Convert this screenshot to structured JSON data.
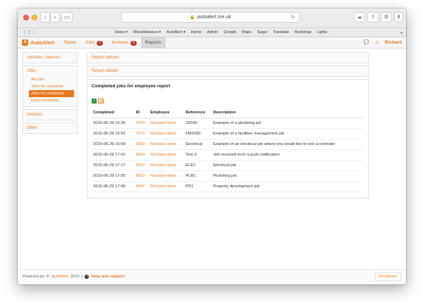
{
  "browser": {
    "url": "autoalert.me.uk",
    "bookmarks": [
      "News ▾",
      "Miscellaneous ▾",
      "AutoAlert ▾",
      "Home",
      "Admin",
      "Google",
      "Maps",
      "Sugar",
      "Translate",
      "Bootstrap",
      "Lights"
    ]
  },
  "app": {
    "brand": "AutoAlert",
    "nav": [
      {
        "label": "Radar"
      },
      {
        "label": "Jobs",
        "badge": "7"
      },
      {
        "label": "Invoices",
        "badge": "2"
      },
      {
        "label": "Reports",
        "active": true
      }
    ],
    "user": "Richard"
  },
  "sidebar": {
    "vehicles": "Vehicles / devices",
    "jobs": "Jobs",
    "jobs_items": [
      "All jobs",
      "Jobs for customer",
      "Jobs for employee",
      "Daily checklists"
    ],
    "jobs_active_index": 2,
    "invoices": "Invoices",
    "other": "Other"
  },
  "main": {
    "report_options": "Report options",
    "report_details": "Report details",
    "report_title": "Completed jobs for employee report",
    "columns": [
      "Completed",
      "ID",
      "Employee",
      "Reference",
      "Description"
    ],
    "rows": [
      [
        "2015-06-29 16:39",
        "7073",
        "Richard Harris",
        "JX540",
        "Example of a plumbing job"
      ],
      [
        "2015-06-29 16:52",
        "7072",
        "Richard Harris",
        "FM3330",
        "Example of a facilities management job"
      ],
      [
        "2015-06-29 16:59",
        "6962",
        "Richard Harris",
        "Electrical",
        "Example of an electrical job where you would like to see a reminder"
      ],
      [
        "2015-06-29 17:02",
        "6814",
        "Richard Harris",
        "Test 3",
        "Job received from a push notification"
      ],
      [
        "2015-06-29 17:17",
        "6813",
        "Richard Harris",
        "ELE1",
        "Electrical job"
      ],
      [
        "2015-06-29 17:05",
        "6812",
        "Richard Harris",
        "PLB1",
        "Plumbing job"
      ],
      [
        "2015-06-29 17:05",
        "6647",
        "Richard Harris",
        "PD1",
        "Property development job"
      ]
    ]
  },
  "footer": {
    "powered_by": "Powered by: ©",
    "brand_year_brand": "AutoAlert",
    "year": "2012",
    "separator": "|",
    "help": "Help and support",
    "feedback": "Feedback"
  },
  "colors": {
    "accent": "#e8781e",
    "badge": "#c0392b"
  }
}
